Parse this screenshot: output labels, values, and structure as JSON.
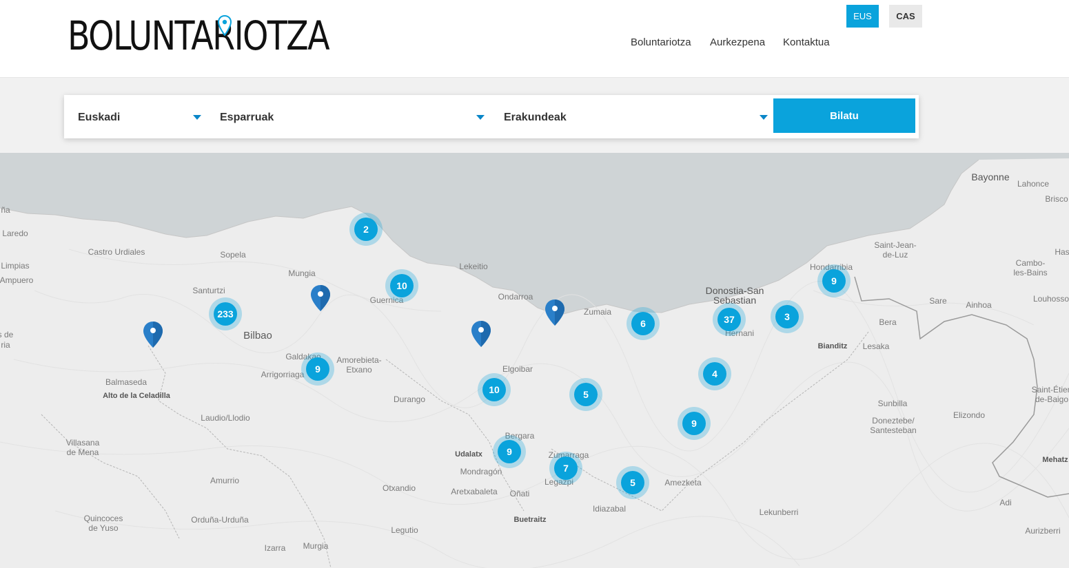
{
  "header": {
    "logo_text": "BOLUNTARIOTZA",
    "languages": [
      {
        "label": "EUS",
        "active": true
      },
      {
        "label": "CAS",
        "active": false
      }
    ],
    "nav": [
      "Boluntariotza",
      "Aurkezpena",
      "Kontaktua"
    ]
  },
  "search": {
    "region": "Euskadi",
    "scope": "Esparruak",
    "organization": "Erakundeak",
    "button": "Bilatu"
  },
  "colors": {
    "accent": "#0aa3dc",
    "marker": "#2a7fc9",
    "sea": "#cfd4d6",
    "land": "#ededed"
  },
  "map": {
    "places": [
      {
        "name": "Laredo",
        "cls": ""
      },
      {
        "name": "Castro Urdiales",
        "cls": ""
      },
      {
        "name": "Limpias",
        "cls": ""
      },
      {
        "name": "Ampuero",
        "cls": ""
      },
      {
        "name": "Sopela",
        "cls": ""
      },
      {
        "name": "Mungia",
        "cls": ""
      },
      {
        "name": "Santurtzi",
        "cls": ""
      },
      {
        "name": "Bilbao",
        "cls": "city"
      },
      {
        "name": "Galdakao",
        "cls": ""
      },
      {
        "name": "Arrigorriaga",
        "cls": ""
      },
      {
        "name": "Amorebieta-\nEtxano",
        "cls": ""
      },
      {
        "name": "Balmaseda",
        "cls": ""
      },
      {
        "name": "Alto de la Celadilla",
        "cls": "bold"
      },
      {
        "name": "Laudio/Llodio",
        "cls": ""
      },
      {
        "name": "Villasana\nde Mena",
        "cls": ""
      },
      {
        "name": "Amurrio",
        "cls": ""
      },
      {
        "name": "Quincoces\nde Yuso",
        "cls": ""
      },
      {
        "name": "Orduña-Urduña",
        "cls": ""
      },
      {
        "name": "Izarra",
        "cls": ""
      },
      {
        "name": "Murgia",
        "cls": ""
      },
      {
        "name": "Legutio",
        "cls": ""
      },
      {
        "name": "Otxandio",
        "cls": ""
      },
      {
        "name": "Durango",
        "cls": ""
      },
      {
        "name": "Guernica",
        "cls": ""
      },
      {
        "name": "Lekeitio",
        "cls": ""
      },
      {
        "name": "Ondarroa",
        "cls": ""
      },
      {
        "name": "Elgoibar",
        "cls": ""
      },
      {
        "name": "Bergara",
        "cls": ""
      },
      {
        "name": "Udalatx",
        "cls": "bold"
      },
      {
        "name": "Mondragón",
        "cls": ""
      },
      {
        "name": "Aretxabaleta",
        "cls": ""
      },
      {
        "name": "Oñati",
        "cls": ""
      },
      {
        "name": "Buetraitz",
        "cls": "bold"
      },
      {
        "name": "Zumarraga",
        "cls": ""
      },
      {
        "name": "Legazpi",
        "cls": ""
      },
      {
        "name": "Idiazabal",
        "cls": ""
      },
      {
        "name": "Zumaia",
        "cls": ""
      },
      {
        "name": "Amezketa",
        "cls": ""
      },
      {
        "name": "Donostia-San\nSebastian",
        "cls": "big"
      },
      {
        "name": "Hernani",
        "cls": ""
      },
      {
        "name": "Hondarribia",
        "cls": ""
      },
      {
        "name": "Saint-Jean-\nde-Luz",
        "cls": ""
      },
      {
        "name": "Bayonne",
        "cls": "big"
      },
      {
        "name": "Lahonce",
        "cls": ""
      },
      {
        "name": "Brisco",
        "cls": ""
      },
      {
        "name": "Cambo-\nles-Bains",
        "cls": ""
      },
      {
        "name": "Has",
        "cls": ""
      },
      {
        "name": "Louhosso",
        "cls": ""
      },
      {
        "name": "Sare",
        "cls": ""
      },
      {
        "name": "Ainhoa",
        "cls": ""
      },
      {
        "name": "Bera",
        "cls": ""
      },
      {
        "name": "Bianditz",
        "cls": "bold"
      },
      {
        "name": "Lesaka",
        "cls": ""
      },
      {
        "name": "Sunbilla",
        "cls": ""
      },
      {
        "name": "Doneztebe/\nSantesteban",
        "cls": ""
      },
      {
        "name": "Elizondo",
        "cls": ""
      },
      {
        "name": "Saint-Étien\nde-Baigo",
        "cls": ""
      },
      {
        "name": "Mehatz",
        "cls": "bold"
      },
      {
        "name": "Adi",
        "cls": ""
      },
      {
        "name": "Lekunberri",
        "cls": ""
      },
      {
        "name": "Aurizberri",
        "cls": ""
      },
      {
        "name": "ña",
        "cls": ""
      },
      {
        "name": "s de",
        "cls": ""
      },
      {
        "name": "ria",
        "cls": ""
      },
      {
        "name": "Balmaseda",
        "cls": "hidden"
      }
    ],
    "clusters": [
      "2",
      "10",
      "233",
      "9",
      "10",
      "9",
      "7",
      "5",
      "5",
      "6",
      "37",
      "3",
      "9",
      "4",
      "9"
    ],
    "marker_count": 4
  }
}
